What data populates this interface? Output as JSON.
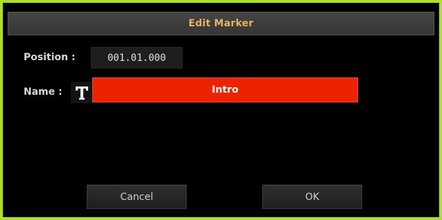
{
  "dialog": {
    "title": "Edit Marker"
  },
  "position": {
    "label": "Position :",
    "value": "001.01.000"
  },
  "name": {
    "label": "Name :",
    "value": "Intro",
    "text_icon": "text-T-icon"
  },
  "buttons": {
    "cancel_label": "Cancel",
    "ok_label": "OK"
  },
  "colors": {
    "frame_border": "#aee02a",
    "title_text": "#e6b45c",
    "name_field": "#ee2200"
  }
}
